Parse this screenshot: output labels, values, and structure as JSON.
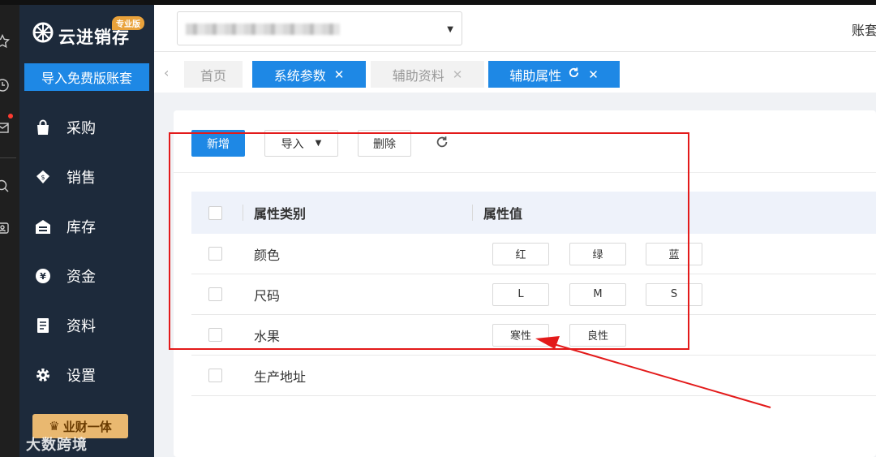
{
  "app": {
    "logo_text": "云进销存",
    "logo_badge": "专业版",
    "import_button": "导入免费版账套",
    "promo_badge": "业财一体",
    "watermark": "大数跨境"
  },
  "sidebar": {
    "items": [
      {
        "label": "采购",
        "icon": "bag-icon"
      },
      {
        "label": "销售",
        "icon": "sales-icon"
      },
      {
        "label": "库存",
        "icon": "warehouse-icon"
      },
      {
        "label": "资金",
        "icon": "yen-icon"
      },
      {
        "label": "资料",
        "icon": "document-icon"
      },
      {
        "label": "设置",
        "icon": "gear-icon"
      }
    ]
  },
  "topbar": {
    "account_label": "账套"
  },
  "tabs": [
    {
      "label": "首页",
      "active": false,
      "closable": false
    },
    {
      "label": "系统参数",
      "active": true,
      "closable": true
    },
    {
      "label": "辅助资料",
      "active": false,
      "closable": true
    },
    {
      "label": "辅助属性",
      "active": true,
      "closable": true,
      "refresh": true
    }
  ],
  "toolbar": {
    "add_label": "新增",
    "import_label": "导入",
    "delete_label": "删除"
  },
  "table": {
    "headers": {
      "category": "属性类别",
      "values": "属性值"
    },
    "rows": [
      {
        "category": "颜色",
        "values": [
          "红",
          "绿",
          "蓝"
        ]
      },
      {
        "category": "尺码",
        "values": [
          "L",
          "M",
          "S"
        ]
      },
      {
        "category": "水果",
        "values": [
          "寒性",
          "良性"
        ]
      },
      {
        "category": "生产地址",
        "values": []
      }
    ]
  },
  "colors": {
    "primary": "#1e88e5",
    "sidebar": "#1d2a3b",
    "annotation": "#e31a1a",
    "promo": "#e9b870"
  }
}
